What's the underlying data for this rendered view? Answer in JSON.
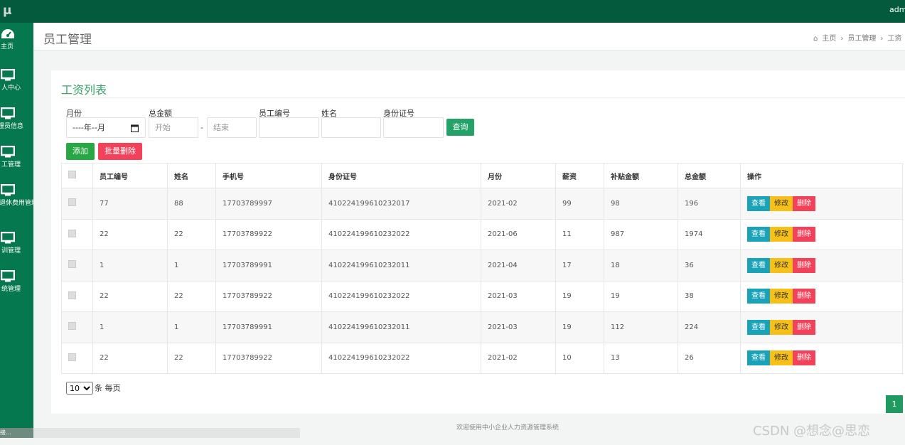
{
  "app": {
    "logo": "μ",
    "user": "admin"
  },
  "sidebar": {
    "items": [
      {
        "label": "主页",
        "icon": "dashboard-icon"
      },
      {
        "label": "人中心",
        "icon": "monitor-icon"
      },
      {
        "label": "理员信息",
        "icon": "monitor-icon"
      },
      {
        "label": "工管理",
        "icon": "monitor-icon"
      },
      {
        "label": "退休费用管理",
        "icon": "monitor-icon"
      },
      {
        "label": "训管理",
        "icon": "monitor-icon"
      },
      {
        "label": "统管理",
        "icon": "monitor-icon"
      }
    ]
  },
  "status": {
    "text": "接..."
  },
  "header": {
    "title": "员工管理",
    "breadcrumb": [
      "主页",
      "员工管理",
      "工资"
    ]
  },
  "card": {
    "title": "工资列表",
    "filters": {
      "month_label": "月份",
      "month_value": "----年--月",
      "total_label": "总金额",
      "start_placeholder": "开始",
      "dash": "-",
      "end_placeholder": "结束",
      "empno_label": "员工编号",
      "name_label": "姓名",
      "idcard_label": "身份证号",
      "search_button": "查询"
    },
    "add_button": "添加",
    "batch_delete_button": "批量删除",
    "table": {
      "headers": [
        "员工编号",
        "姓名",
        "手机号",
        "身份证号",
        "月份",
        "薪资",
        "补贴金额",
        "总金额",
        "操作"
      ],
      "rows": [
        [
          "77",
          "88",
          "17703789997",
          "410224199610232017",
          "2021-02",
          "99",
          "98",
          "196"
        ],
        [
          "22",
          "22",
          "17703789922",
          "410224199610232022",
          "2021-06",
          "11",
          "987",
          "1974"
        ],
        [
          "1",
          "1",
          "17703789991",
          "410224199610232011",
          "2021-04",
          "17",
          "18",
          "36"
        ],
        [
          "22",
          "22",
          "17703789922",
          "410224199610232022",
          "2021-03",
          "19",
          "19",
          "38"
        ],
        [
          "1",
          "1",
          "17703789991",
          "410224199610232011",
          "2021-03",
          "19",
          "112",
          "224"
        ],
        [
          "22",
          "22",
          "17703789922",
          "410224199610232022",
          "2021-02",
          "10",
          "13",
          "26"
        ]
      ],
      "actions": {
        "view": "查看",
        "edit": "修改",
        "delete": "删除"
      }
    },
    "pager": {
      "page_size": "10",
      "per_page_label": "条 每页",
      "current_page": "1"
    }
  },
  "footer": {
    "text": "欢迎使用中小企业人力资源管理系统"
  },
  "watermark": "CSDN @想念@思恋",
  "colors": {
    "topbar": "#045a3d",
    "sidebar": "#05784f",
    "accent": "#3aa36e",
    "view": "#1aa3b8",
    "edit": "#f6c019",
    "delete": "#f24159"
  }
}
